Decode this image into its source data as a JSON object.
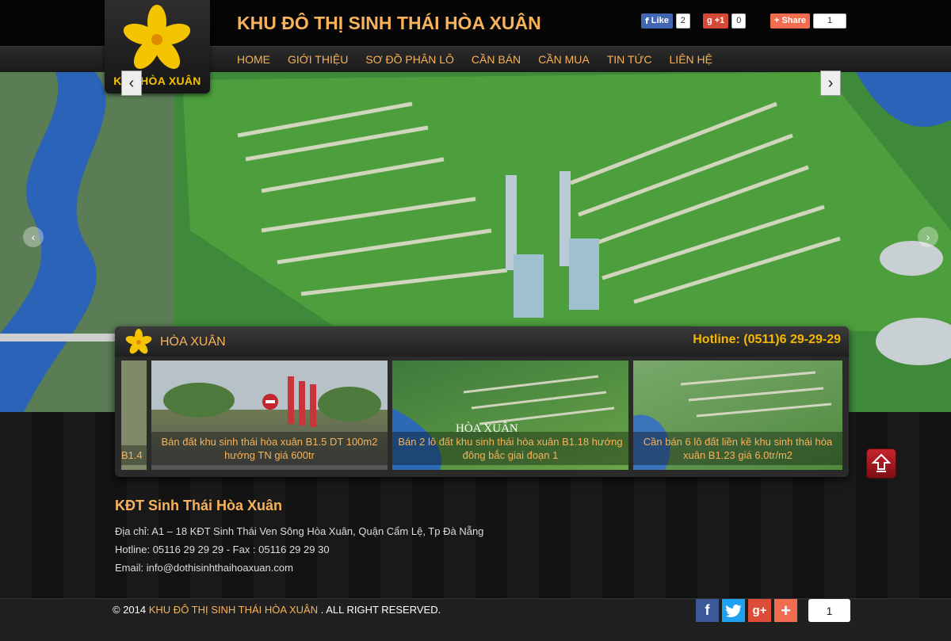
{
  "header": {
    "logo_text": "KĐT HÒA XUÂN",
    "site_title": "KHU ĐÔ THỊ SINH THÁI HÒA XUÂN",
    "social": {
      "like_label": "Like",
      "like_count": "2",
      "gplus_label": "+1",
      "gplus_count": "0",
      "share_label": "Share",
      "share_count": "1"
    }
  },
  "nav": {
    "items": [
      {
        "label": "HOME"
      },
      {
        "label": "GIỚI THIỆU"
      },
      {
        "label": "SƠ ĐỒ PHÂN LÔ"
      },
      {
        "label": "CẦN BÁN"
      },
      {
        "label": "CẦN MUA"
      },
      {
        "label": "TIN TỨC"
      },
      {
        "label": "LIÊN HỆ"
      }
    ]
  },
  "panel": {
    "title": "HÒA XUÂN",
    "hotline": "Hotline: (0511)6 29-29-29",
    "slides": [
      {
        "caption": "B1.4"
      },
      {
        "caption": "Bán đất khu sinh thái hòa xuân B1.5 DT 100m2 hướng TN giá 600tr"
      },
      {
        "caption": "Bán 2 lô đất khu sinh thái hòa xuân B1.18 hướng đông bắc giai đoạn 1"
      },
      {
        "caption": "Cần bán 6 lô đất liền kề khu sinh thái hòa xuân B1.23 giá 6.0tr/m2"
      }
    ],
    "slide_overlay_text": "HÒA XUÂN"
  },
  "contact": {
    "name": "KĐT Sinh Thái Hòa Xuân",
    "address": "Địa chỉ: A1 – 18 KĐT Sinh Thái Ven Sông Hòa Xuân, Quận Cẩm Lệ, Tp Đà Nẵng",
    "hotline": "Hotline: 05116 29 29 29 - Fax : 05116 29 29 30",
    "email": "Email: info@dothisinhthaihoaxuan.com"
  },
  "footer": {
    "copy_prefix": "© 2014",
    "copy_name": "KHU ĐÔ THỊ SINH THÁI HÒA XUÂN",
    "copy_suffix": ". ALL RIGHT RESERVED.",
    "share_count": "1"
  },
  "colors": {
    "accent": "#f7b25a",
    "hotline": "#f5b800",
    "logo_yellow": "#f5c400"
  }
}
